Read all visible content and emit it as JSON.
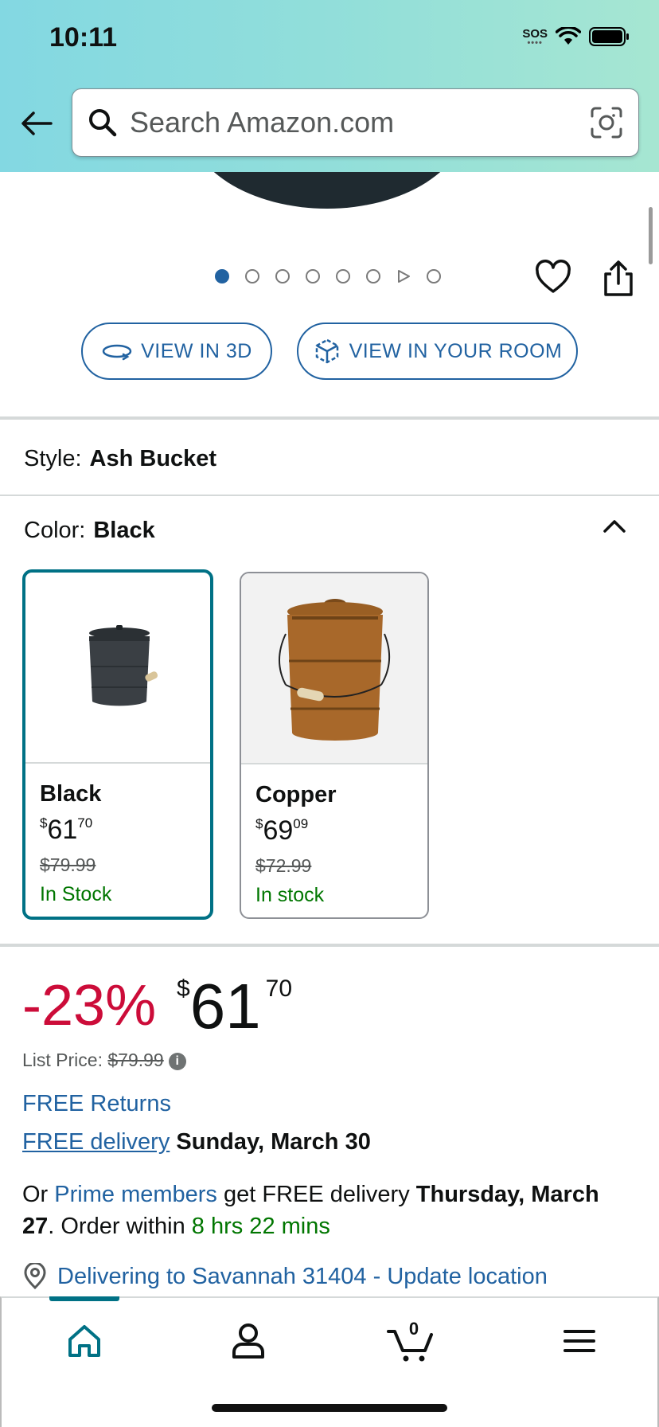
{
  "status_bar": {
    "time": "10:11",
    "sos": "SOS"
  },
  "search": {
    "placeholder": "Search Amazon.com"
  },
  "carousel": {
    "total_dots": 8,
    "active_index": 0
  },
  "view_buttons": {
    "view_3d": "VIEW IN 3D",
    "view_room": "VIEW IN YOUR ROOM"
  },
  "style": {
    "label": "Style:",
    "value": "Ash Bucket"
  },
  "color": {
    "label": "Color:",
    "value": "Black"
  },
  "swatches": [
    {
      "name": "Black",
      "currency": "$",
      "price_whole": "61",
      "price_cents": "70",
      "was_price": "$79.99",
      "stock": "In Stock"
    },
    {
      "name": "Copper",
      "currency": "$",
      "price_whole": "69",
      "price_cents": "09",
      "was_price": "$72.99",
      "stock": "In stock"
    }
  ],
  "price": {
    "discount": "-23%",
    "currency": "$",
    "whole": "61",
    "cents": "70",
    "list_label": "List Price:",
    "list_value": "$79.99"
  },
  "delivery": {
    "free_returns": "FREE Returns",
    "free_delivery_link": "FREE delivery",
    "free_delivery_date": "Sunday, March 30",
    "prime_prefix": "Or",
    "prime_link": "Prime members",
    "prime_mid": "get FREE delivery",
    "prime_date_a": "Thursday, March",
    "prime_date_b": "27",
    "order_within_prefix": ". Order within",
    "order_within_time": "8 hrs 22 mins",
    "location": "Delivering to Savannah 31404 - Update location"
  },
  "bottom_nav": {
    "cart_count": "0"
  },
  "colors": {
    "link": "#2162a1",
    "deal_red": "#cc0c39",
    "stock_green": "#007600",
    "selected_teal": "#007185"
  }
}
